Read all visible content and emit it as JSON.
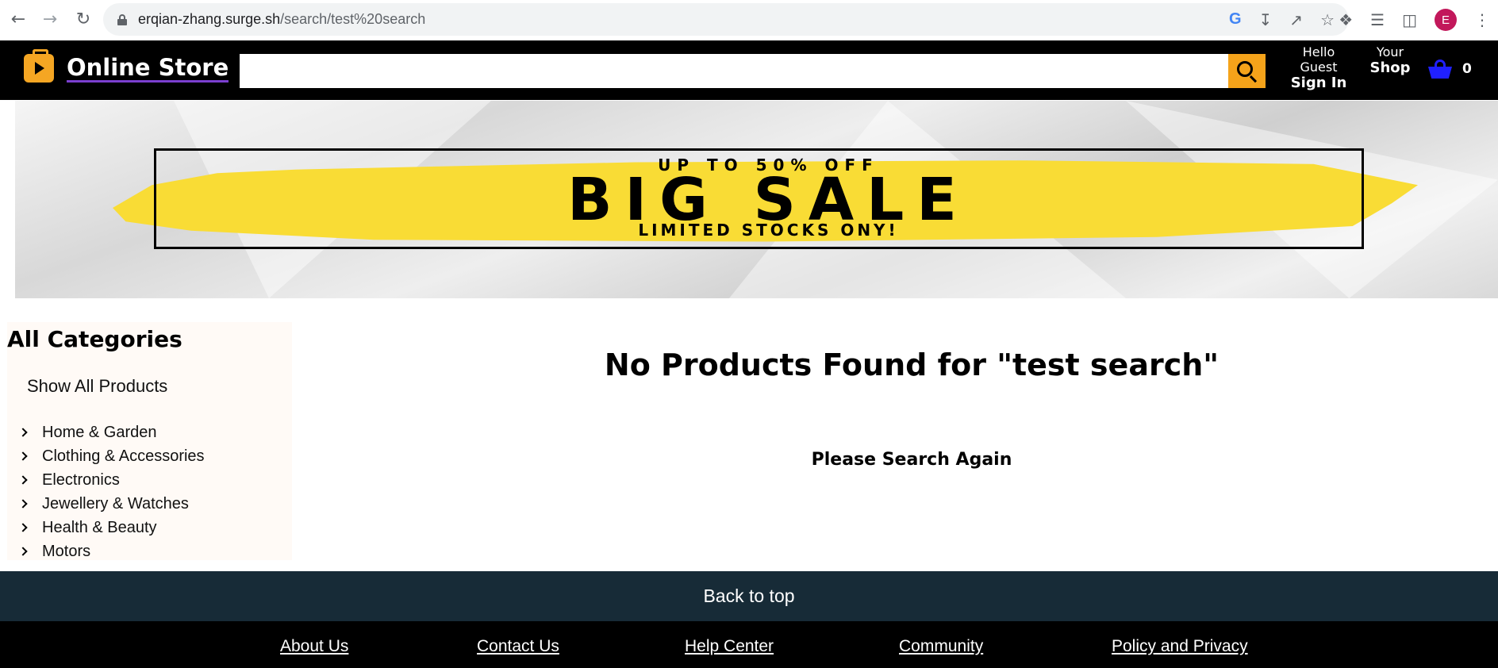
{
  "browser": {
    "url_host": "erqian-zhang.surge.sh",
    "url_path": "/search/test%20search",
    "avatar_letter": "E",
    "icons": [
      "back-icon",
      "forward-icon",
      "reload-icon",
      "lock-icon",
      "google-icon",
      "install-icon",
      "share-icon",
      "star-icon",
      "extensions-icon",
      "reading-list-icon",
      "side-panel-icon"
    ]
  },
  "header": {
    "logo_text": "Online Store",
    "search_value": "",
    "sign_in_small": "Hello Guest",
    "sign_in_big": "Sign In",
    "shop_small": "Your",
    "shop_big": "Shop",
    "cart_count": "0",
    "colors": {
      "accent": "#f5a31a",
      "cart": "#2020ff",
      "background": "#000000"
    }
  },
  "banner": {
    "top_text": "UP TO 50% OFF",
    "main_text": "BIG SALE",
    "bottom_text": "LIMITED STOCKS ONY!",
    "paint_color": "#f9dc35"
  },
  "sidebar": {
    "title": "All Categories",
    "show_all": "Show All Products",
    "categories": [
      "Home & Garden",
      "Clothing & Accessories",
      "Electronics",
      "Jewellery & Watches",
      "Health & Beauty",
      "Motors"
    ]
  },
  "main": {
    "title": "No Products Found for \"test search\"",
    "subtitle": "Please Search Again"
  },
  "footer": {
    "back_to_top": "Back to top",
    "links": [
      "About Us",
      "Contact Us",
      "Help Center",
      "Community",
      "Policy and Privacy"
    ],
    "back_to_top_color": "#172b37"
  }
}
